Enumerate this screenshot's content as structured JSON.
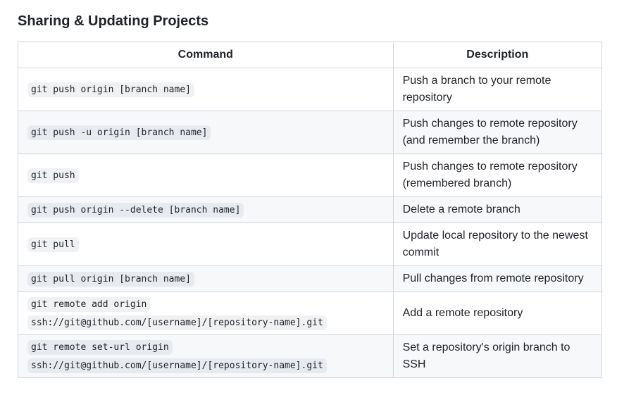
{
  "section": {
    "title": "Sharing & Updating Projects"
  },
  "table": {
    "headers": {
      "command": "Command",
      "description": "Description"
    },
    "rows": [
      {
        "command": "git push origin [branch name]",
        "description": "Push a branch to your remote repository"
      },
      {
        "command": "git push -u origin [branch name]",
        "description": "Push changes to remote repository (and remember the branch)"
      },
      {
        "command": "git push",
        "description": "Push changes to remote repository (remembered branch)"
      },
      {
        "command": "git push origin --delete [branch name]",
        "description": "Delete a remote branch"
      },
      {
        "command": "git pull",
        "description": "Update local repository to the newest commit"
      },
      {
        "command": "git pull origin [branch name]",
        "description": "Pull changes from remote repository"
      },
      {
        "command": "git remote add origin ssh://git@github.com/[username]/[repository-name].git",
        "description": "Add a remote repository"
      },
      {
        "command": "git remote set-url origin ssh://git@github.com/[username]/[repository-name].git",
        "description": "Set a repository's origin branch to SSH"
      }
    ]
  }
}
